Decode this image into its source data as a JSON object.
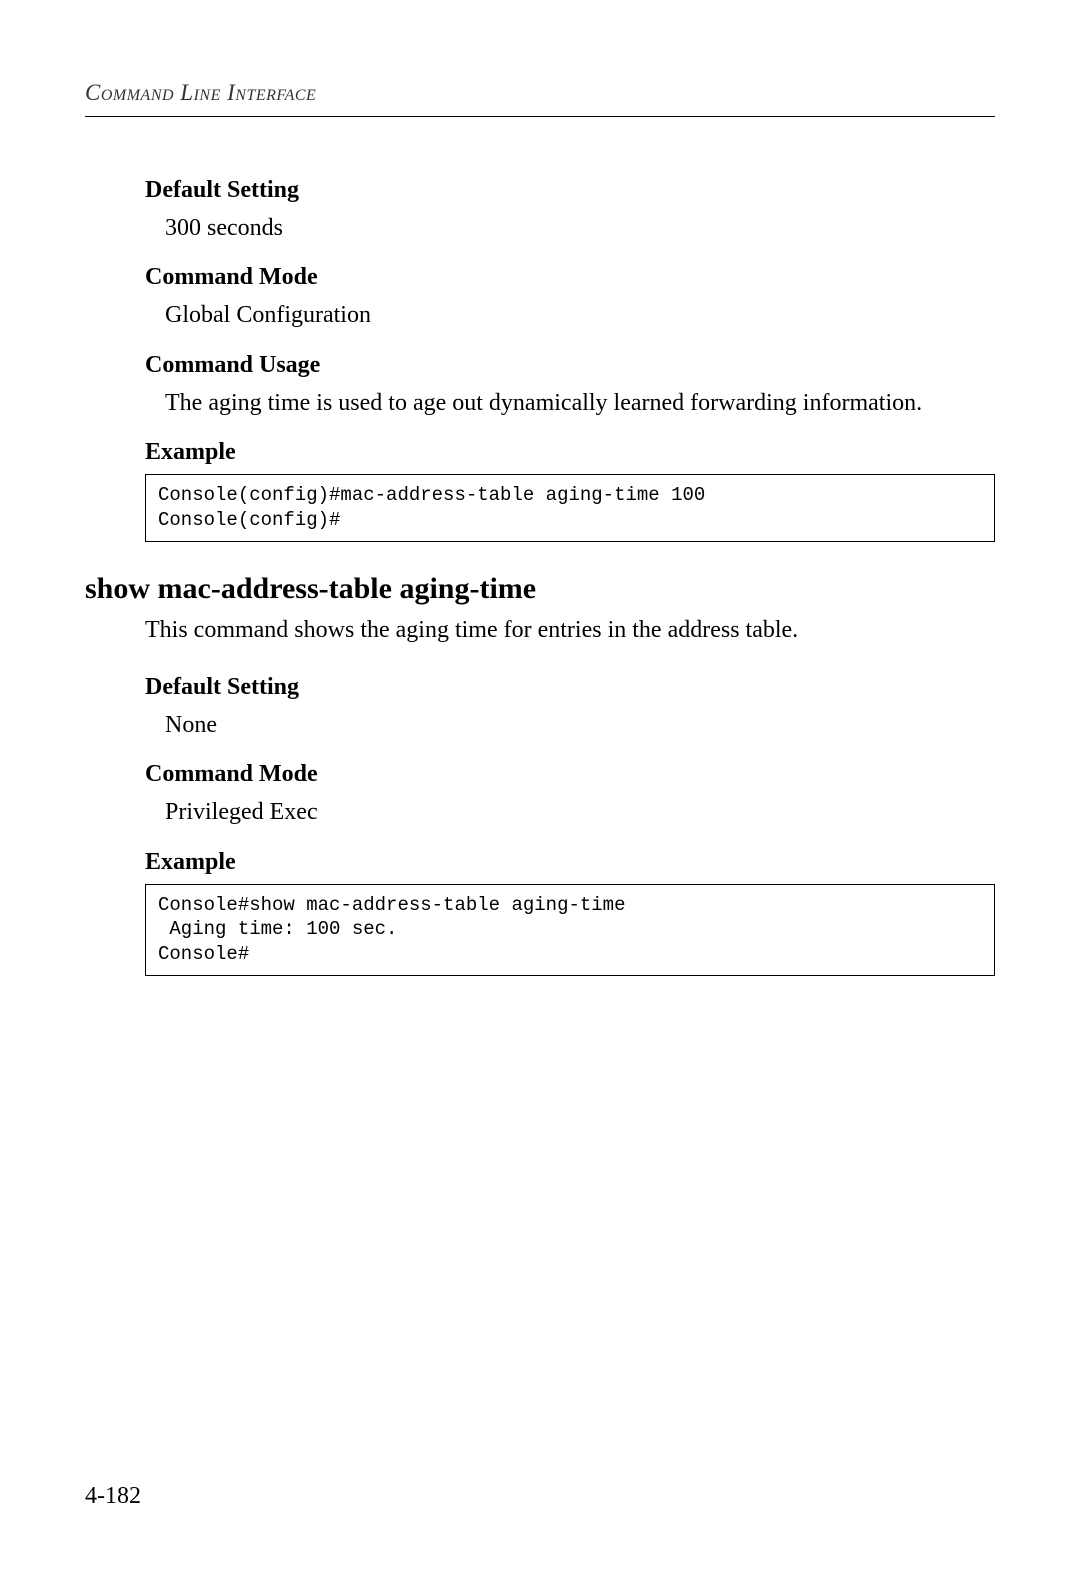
{
  "page_header": "Command Line Interface",
  "section1": {
    "default_setting_label": "Default Setting",
    "default_setting_value": "300 seconds",
    "command_mode_label": "Command Mode",
    "command_mode_value": "Global Configuration",
    "command_usage_label": "Command Usage",
    "command_usage_text": "The aging time is used to age out dynamically learned forwarding information.",
    "example_label": "Example",
    "example_code": "Console(config)#mac-address-table aging-time 100\nConsole(config)#"
  },
  "command2": {
    "title": "show mac-address-table aging-time",
    "description": "This command shows the aging time for entries in the address table.",
    "default_setting_label": "Default Setting",
    "default_setting_value": "None",
    "command_mode_label": "Command Mode",
    "command_mode_value": "Privileged Exec",
    "example_label": "Example",
    "example_code": "Console#show mac-address-table aging-time\n Aging time: 100 sec.\nConsole#"
  },
  "page_number": "4-182"
}
